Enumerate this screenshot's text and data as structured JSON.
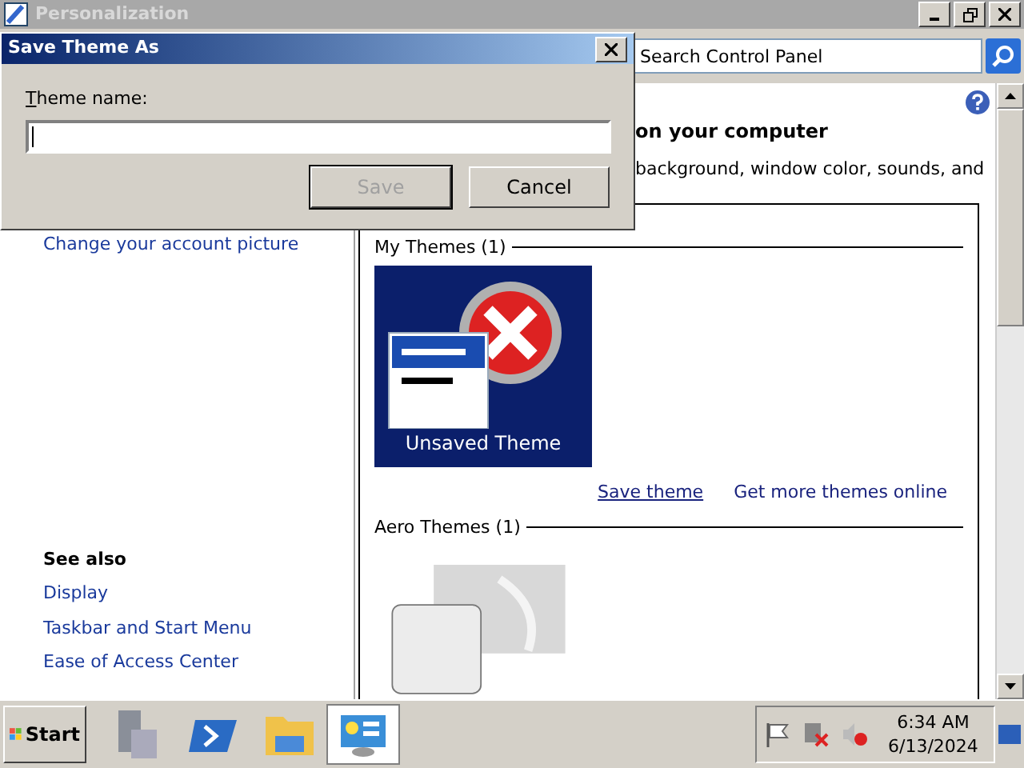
{
  "window": {
    "title": "Personalization"
  },
  "search": {
    "placeholder": "Search Control Panel"
  },
  "header": {
    "title": "on your computer",
    "description": "background, window color, sounds, and"
  },
  "left_links": [
    {
      "label": "Change your account picture"
    }
  ],
  "see_also": {
    "title": "See also",
    "links": [
      "Display",
      "Taskbar and Start Menu",
      "Ease of Access Center"
    ]
  },
  "my_themes": {
    "title": "My Themes (1)",
    "themes": [
      {
        "label": "Unsaved Theme",
        "selected": true
      }
    ],
    "links": [
      {
        "label": "Save theme",
        "focused": true
      },
      {
        "label": "Get more themes online",
        "focused": false
      }
    ]
  },
  "aero_themes": {
    "title": "Aero Themes (1)"
  },
  "dialog": {
    "title": "Save Theme As",
    "field_label": "Theme name:",
    "buttons": [
      {
        "label": "Save",
        "disabled": true
      },
      {
        "label": "Cancel",
        "disabled": false
      }
    ]
  },
  "taskbar": {
    "start": "Start",
    "clock_time": "6:34 AM",
    "clock_date": "6/13/2024"
  }
}
